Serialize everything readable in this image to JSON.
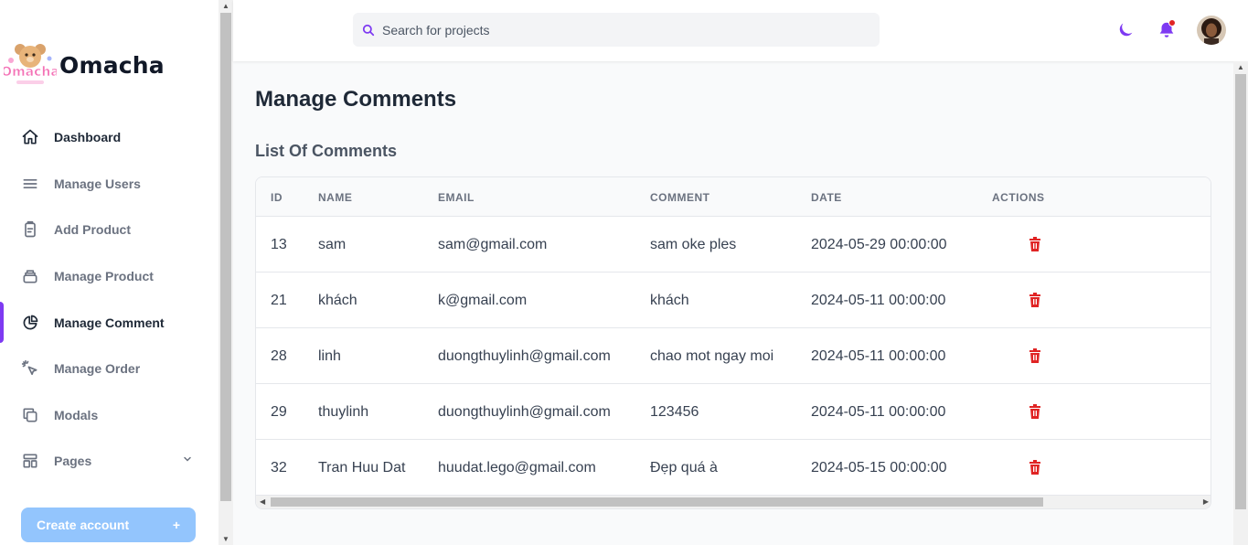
{
  "brand": {
    "name": "Omacha",
    "logo_text": "Omacha"
  },
  "sidebar": {
    "items": [
      {
        "label": "Dashboard",
        "icon": "home-icon"
      },
      {
        "label": "Manage Users",
        "icon": "list-icon"
      },
      {
        "label": "Add Product",
        "icon": "clipboard-icon"
      },
      {
        "label": "Manage Product",
        "icon": "stack-icon"
      },
      {
        "label": "Manage Comment",
        "icon": "chart-pie-icon",
        "active": true
      },
      {
        "label": "Manage Order",
        "icon": "cursor-click-icon"
      },
      {
        "label": "Modals",
        "icon": "duplicate-icon"
      },
      {
        "label": "Pages",
        "icon": "template-icon",
        "has_chevron": true
      }
    ],
    "create_account": {
      "label": "Create account",
      "plus": "+"
    }
  },
  "header": {
    "search_placeholder": "Search for projects",
    "icons": [
      "moon-icon",
      "bell-icon",
      "avatar"
    ],
    "notification_dot": true
  },
  "main": {
    "title": "Manage Comments",
    "section_title": "List Of Comments",
    "table": {
      "columns": [
        "ID",
        "NAME",
        "EMAIL",
        "COMMENT",
        "DATE",
        "ACTIONS"
      ],
      "rows": [
        {
          "id": "13",
          "name": "sam",
          "email": "sam@gmail.com",
          "comment": "sam oke ples",
          "date": "2024-05-29 00:00:00"
        },
        {
          "id": "21",
          "name": "khách",
          "email": "k@gmail.com",
          "comment": "khách",
          "date": "2024-05-11 00:00:00"
        },
        {
          "id": "28",
          "name": "linh",
          "email": "duongthuylinh@gmail.com",
          "comment": "chao mot ngay moi",
          "date": "2024-05-11 00:00:00"
        },
        {
          "id": "29",
          "name": "thuylinh",
          "email": "duongthuylinh@gmail.com",
          "comment": "123456",
          "date": "2024-05-11 00:00:00"
        },
        {
          "id": "32",
          "name": "Tran Huu Dat",
          "email": "huudat.lego@gmail.com",
          "comment": "Đẹp quá à",
          "date": "2024-05-15 00:00:00"
        }
      ]
    }
  },
  "colors": {
    "accent": "#7e3af2",
    "danger": "#e02424",
    "button_bg": "#93c5fd"
  }
}
